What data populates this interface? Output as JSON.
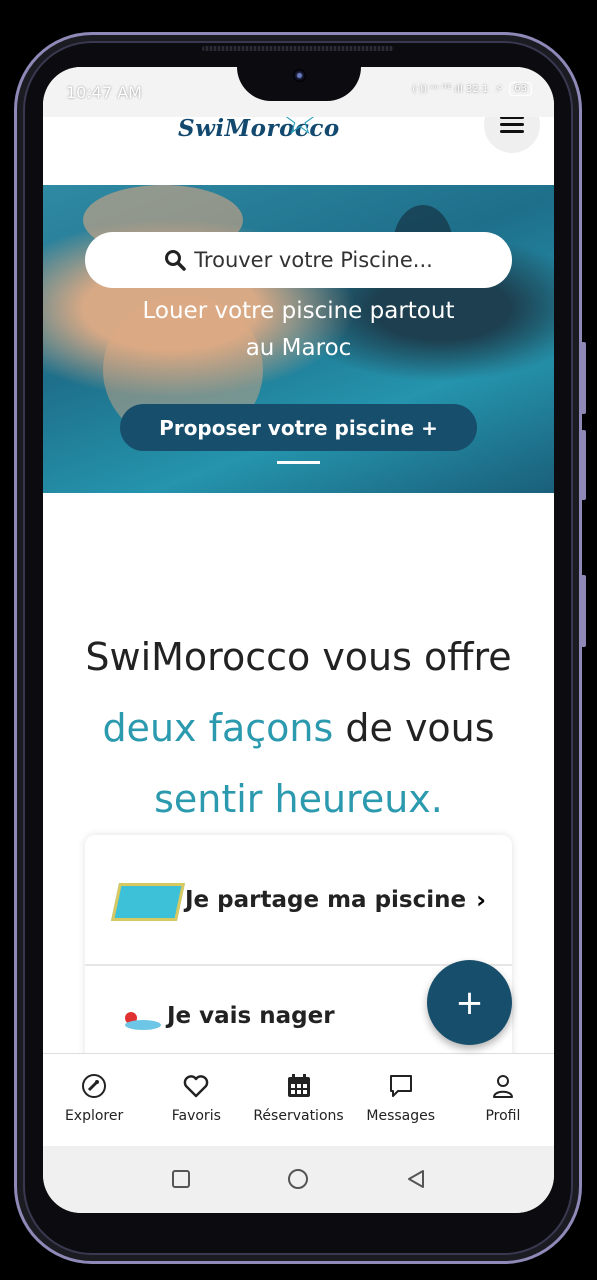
{
  "status": {
    "time": "10:47 AM",
    "icons": "(·)) ᵛᵒ ˡᵀᴱ ıll 32.1",
    "battery": "63"
  },
  "header": {
    "logo": "SwiMorocco"
  },
  "hero": {
    "search_placeholder": "Trouver votre Piscine...",
    "tagline": "Louer votre piscine partout au Maroc",
    "cta": "Proposer votre piscine +"
  },
  "intro": {
    "prefix": "SwiMorocco vous offre ",
    "h1": "deux façons",
    "mid": " de vous ",
    "h2": "sentir heureux."
  },
  "options": [
    {
      "label": "Je partage ma piscine"
    },
    {
      "label": "Je vais nager"
    }
  ],
  "fab": "+",
  "tabs": [
    {
      "label": "Explorer",
      "icon": "explore-icon"
    },
    {
      "label": "Favoris",
      "icon": "heart-icon"
    },
    {
      "label": "Réservations",
      "icon": "calendar-icon"
    },
    {
      "label": "Messages",
      "icon": "message-icon"
    },
    {
      "label": "Profil",
      "icon": "user-icon"
    }
  ],
  "colors": {
    "primary": "#174e6c",
    "accent": "#2c9aae"
  }
}
